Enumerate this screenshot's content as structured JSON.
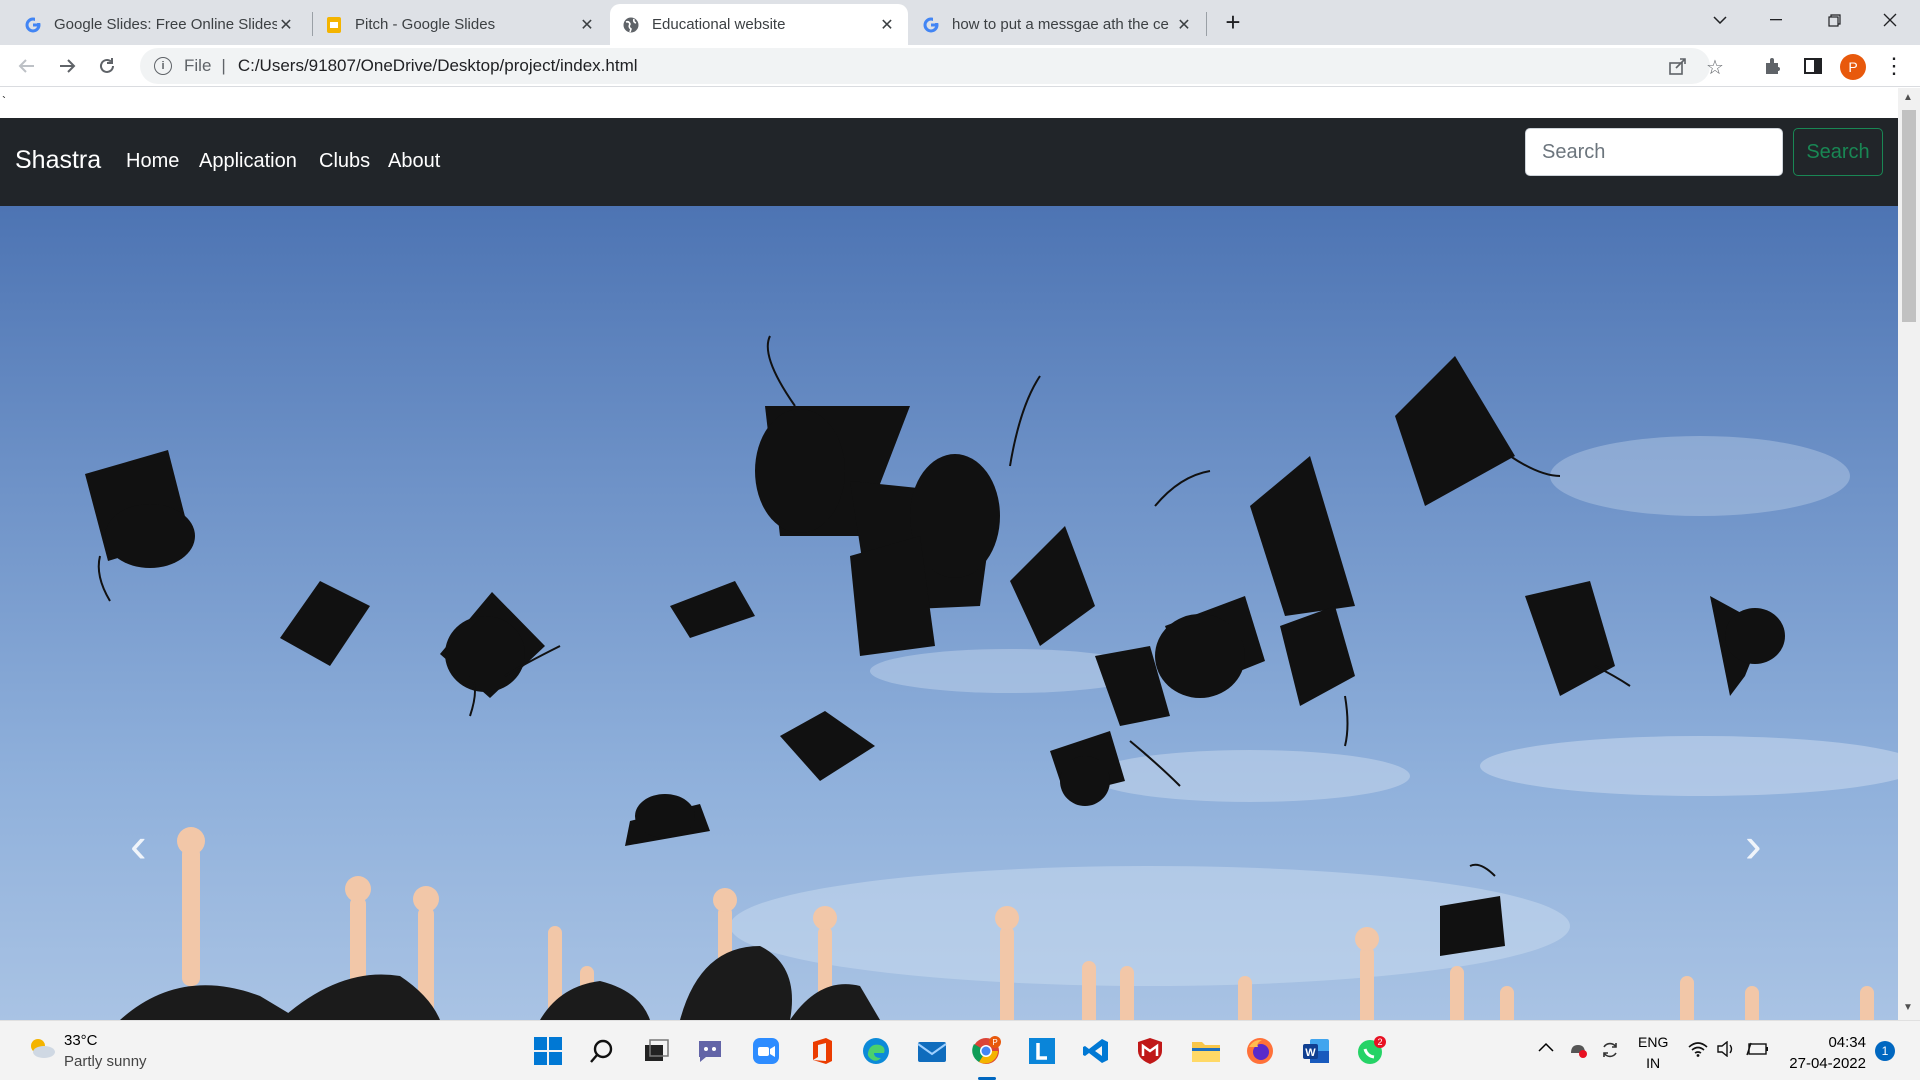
{
  "browser": {
    "tabs": [
      {
        "title": "Google Slides: Free Online Slides",
        "icon": "google-icon"
      },
      {
        "title": "Pitch - Google Slides",
        "icon": "slides-icon"
      },
      {
        "title": "Educational website",
        "icon": "globe-icon",
        "active": true
      },
      {
        "title": "how to put a messgae ath the ce",
        "icon": "google-icon"
      }
    ],
    "address": {
      "scheme": "File",
      "url": "C:/Users/91807/OneDrive/Desktop/project/index.html"
    },
    "profile_initial": "P"
  },
  "page": {
    "stray_char": "`",
    "navbar": {
      "brand": "Shastra",
      "links": [
        "Home",
        "Application",
        "Clubs",
        "About"
      ],
      "search_placeholder": "Search",
      "search_button": "Search"
    },
    "carousel": {
      "prev": "‹",
      "next": "›"
    }
  },
  "taskbar": {
    "weather": {
      "temp": "33°C",
      "desc": "Partly sunny"
    },
    "lang": "ENG",
    "region": "IN",
    "time": "04:34",
    "date": "27-04-2022",
    "notifications": "1",
    "whatsapp_badge": "2",
    "chrome_badge": "P"
  },
  "colors": {
    "navbar_bg": "#212529",
    "search_button": "#198754",
    "profile": "#e8590c"
  }
}
